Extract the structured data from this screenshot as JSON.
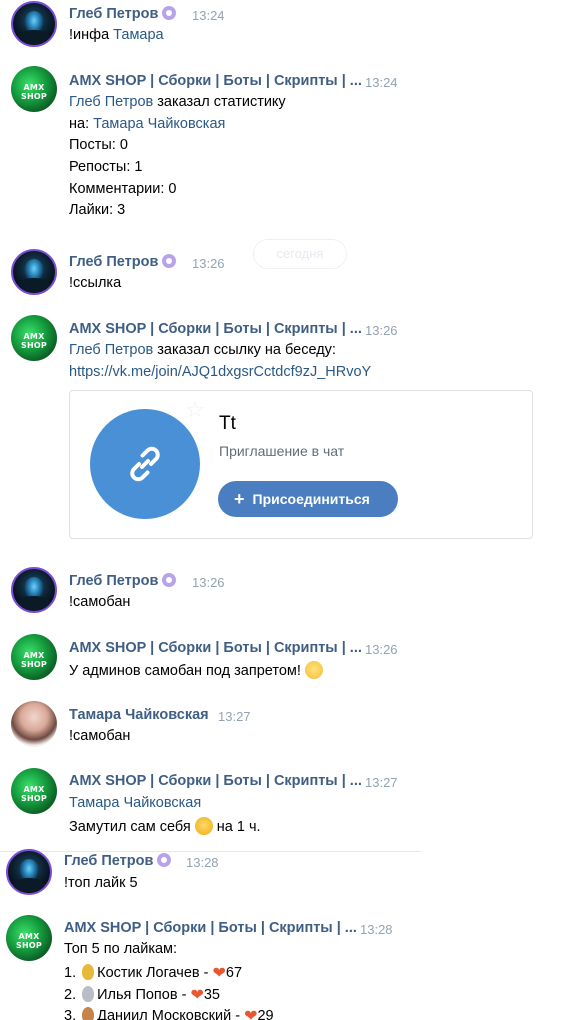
{
  "messages": [
    {
      "author": "Глеб Петров",
      "time": "13:24",
      "lines": [
        {
          "prefix": "!инфа ",
          "link": "Тамара"
        }
      ]
    },
    {
      "author": "AMX SHOP | Сборки | Боты | Скрипты | ...",
      "time": "13:24",
      "lines": [
        {
          "link": "Глеб Петров",
          "text": " заказал статистику"
        },
        {
          "prefix": "на: ",
          "link": "Тамара Чайковская"
        },
        {
          "text": "Посты: 0"
        },
        {
          "text": "Репосты: 1"
        },
        {
          "text": "Комментарии: 0"
        },
        {
          "text": "Лайки: 3"
        }
      ]
    },
    {
      "author": "Глеб Петров",
      "time": "13:26",
      "lines": [
        {
          "text": "!ссылка"
        }
      ]
    },
    {
      "author": "AMX SHOP | Сборки | Боты | Скрипты | ...",
      "time": "13:26",
      "lines": [
        {
          "link": "Глеб Петров",
          "text": " заказал ссылку на беседу:"
        },
        {
          "link": "https://vk.me/join/AJQ1dxgsrCctdcf9zJ_HRvoY"
        }
      ]
    },
    {
      "author": "Глеб Петров",
      "time": "13:26",
      "lines": [
        {
          "text": "!самобан"
        }
      ]
    },
    {
      "author": "AMX SHOP | Сборки | Боты | Скрипты | ...",
      "time": "13:26",
      "lines": [
        {
          "text": "У админов самобан под запретом!"
        }
      ]
    },
    {
      "author": "Тамара Чайковская",
      "time": "13:27",
      "lines": [
        {
          "text": "!самобан"
        }
      ]
    },
    {
      "author": "AMX SHOP | Сборки | Боты | Скрипты | ...",
      "time": "13:27",
      "lines": [
        {
          "link": "Тамара Чайковская"
        },
        {
          "text": "Замутил сам себя",
          "suffix": " на 1 ч."
        }
      ]
    },
    {
      "author": "Глеб Петров",
      "time": "13:28",
      "lines": [
        {
          "text": "!топ лайк 5"
        }
      ]
    },
    {
      "author": "AMX SHOP | Сборки | Боты | Скрипты | ...",
      "time": "13:28",
      "lines": [
        {
          "text": "Топ 5 по лайкам:"
        },
        {
          "num": "1.",
          "name": "Костик Логачев - ",
          "count": "67"
        },
        {
          "num": "2.",
          "name": "Илья Попов - ",
          "count": "35"
        },
        {
          "num": "3.",
          "name": "Даниил Московский - ",
          "count": "29"
        }
      ]
    }
  ],
  "date_separator": "сегодня",
  "invite_card": {
    "title": "Tt",
    "subtitle": "Приглашение в чат",
    "button": "Присоединиться",
    "plus": "+"
  },
  "icons": {
    "sticker": "sticker-icon",
    "link": "link-icon",
    "star": "star-icon",
    "flushed": "flushed-face-emoji",
    "upside": "upside-down-face-emoji",
    "medals": [
      "gold-medal-icon",
      "silver-medal-icon",
      "bronze-medal-icon"
    ],
    "heart": "heart-emoji"
  },
  "colors": {
    "name": "#3f5e83",
    "link": "#2a5885",
    "time": "#93a3b3",
    "button": "#4a7ec0",
    "card_circle": "#4a90d6",
    "medal_gold": "#e8b83a",
    "medal_silver": "#b9bec6",
    "medal_bronze": "#c7834a"
  }
}
